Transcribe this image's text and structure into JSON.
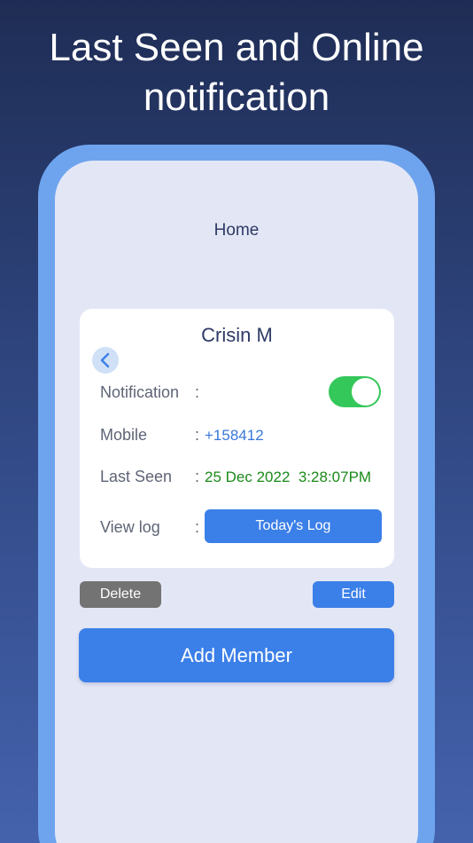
{
  "headline": {
    "line1": "Last Seen and Online",
    "line2": "notification"
  },
  "nav": {
    "title": "Home"
  },
  "member": {
    "name": "Crisin M",
    "rows": {
      "notification": {
        "label": "Notification",
        "colon": ":",
        "enabled": true
      },
      "mobile": {
        "label": "Mobile",
        "colon": ":",
        "value": "+158412"
      },
      "last_seen": {
        "label": "Last Seen",
        "colon": ":",
        "value": "25 Dec 2022  3:28:07PM"
      },
      "view_log": {
        "label": "View log",
        "colon": ":",
        "button": "Today's Log"
      }
    }
  },
  "actions": {
    "delete": "Delete",
    "edit": "Edit",
    "add_member": "Add Member"
  },
  "colors": {
    "accent": "#3b7fe8",
    "toggle_on": "#34c759",
    "last_seen_text": "#1a8a1a",
    "delete_button": "#737373"
  },
  "icons": {
    "back": "chevron-left-icon"
  }
}
